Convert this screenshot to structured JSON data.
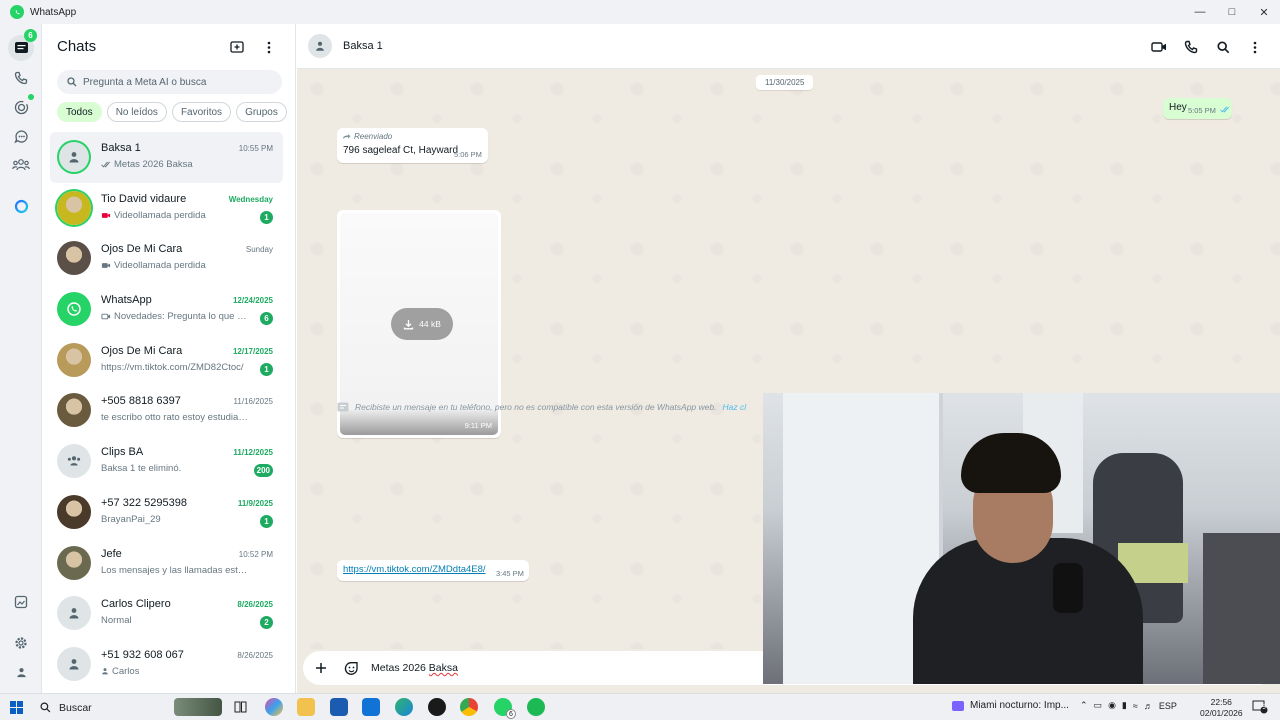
{
  "window": {
    "title": "WhatsApp"
  },
  "rail": {
    "chats_badge": "6"
  },
  "sidebar": {
    "title": "Chats",
    "search_placeholder": "Pregunta a Meta AI o busca",
    "filters": [
      "Todos",
      "No leídos",
      "Favoritos",
      "Grupos"
    ],
    "chats": [
      {
        "name": "Baksa 1",
        "time": "10:55 PM",
        "preview": "Metas 2026 Baksa",
        "badge": "",
        "icon": "double-check-icon",
        "avatar": "default"
      },
      {
        "name": "Tio David vidaure",
        "time": "Wednesday",
        "preview": "Videollamada perdida",
        "badge": "1",
        "icon": "missed-video-icon",
        "avatar": "photo",
        "avatar_color": "#c8b820"
      },
      {
        "name": "Ojos De Mi Cara",
        "time": "Sunday",
        "preview": "Videollamada perdida",
        "badge": "",
        "icon": "video-icon",
        "avatar": "photo",
        "avatar_color": "#5a5048"
      },
      {
        "name": "WhatsApp",
        "time": "12/24/2025",
        "preview": "Novedades: Pregunta lo que qui...",
        "badge": "6",
        "icon": "video-outline-icon",
        "avatar": "whatsapp",
        "avatar_color": "#25d366"
      },
      {
        "name": "Ojos De Mi Cara",
        "time": "12/17/2025",
        "preview": "https://vm.tiktok.com/ZMD82Ctoc/",
        "badge": "1",
        "icon": "",
        "avatar": "photo",
        "avatar_color": "#b89a5a"
      },
      {
        "name": "+505 8818 6397",
        "time": "11/16/2025",
        "preview": "te escribo otto rato estoy estudiando p...",
        "badge": "",
        "icon": "",
        "avatar": "photo",
        "avatar_color": "#6a5a3e"
      },
      {
        "name": "Clips BA",
        "time": "11/12/2025",
        "preview": "Baksa 1 te eliminó.",
        "badge": "200",
        "icon": "",
        "avatar": "group"
      },
      {
        "name": "+57 322 5295398",
        "time": "11/9/2025",
        "preview": "BrayanPai_29",
        "badge": "1",
        "icon": "",
        "avatar": "photo",
        "avatar_color": "#4a3a2a"
      },
      {
        "name": "Jefe",
        "time": "10:52 PM",
        "preview": "Los mensajes y las llamadas están cifr...",
        "badge": "",
        "icon": "",
        "avatar": "photo",
        "avatar_color": "#6b6a50"
      },
      {
        "name": "Carlos Clipero",
        "time": "8/26/2025",
        "preview": "Normal",
        "badge": "2",
        "icon": "",
        "avatar": "default"
      },
      {
        "name": "+51 932 608 067",
        "time": "8/26/2025",
        "preview": "Carlos",
        "badge": "",
        "icon": "person-small-icon",
        "avatar": "default"
      }
    ]
  },
  "conversation": {
    "name": "Baksa 1",
    "date_separator": "11/30/2025",
    "out_message": {
      "text": "Hey",
      "time": "5:05 PM"
    },
    "forwarded_label": "Reenviado",
    "address_message": {
      "text": "796 sageleaf Ct, Hayward",
      "time": "5:06 PM"
    },
    "media": {
      "size": "44 kB",
      "time": "9:11 PM"
    },
    "system_note": {
      "text": "Recibiste un mensaje en tu teléfono, pero no es compatible con esta versión de WhatsApp web.",
      "link": "Haz cl"
    },
    "link_message": {
      "text": "https://vm.tiktok.com/ZMDdta4E8/",
      "time": "3:45 PM"
    },
    "composer": {
      "text_plain": "Metas 2026 ",
      "text_misspelled": "Baksa"
    }
  },
  "taskbar": {
    "search_label": "Buscar",
    "whatsapp_badge": "6",
    "media_title": "Miami nocturno: Imp...",
    "language": "ESP",
    "time": "22:56",
    "date": "02/01/2026",
    "notification_count": "5"
  }
}
